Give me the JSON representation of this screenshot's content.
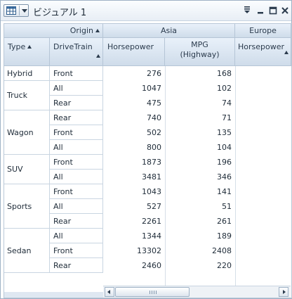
{
  "window": {
    "title": "ビジュアル 1"
  },
  "icons": {
    "menu": "grid-icon",
    "chevron": "chevron-down-icon",
    "filter": "filter-icon",
    "minimize": "minimize-icon",
    "maximize": "maximize-icon",
    "close": "close-icon"
  },
  "columns": {
    "origin_label": "Origin",
    "type_label": "Type",
    "drivetrain_label": "DriveTrain",
    "groups": [
      "Asia",
      "Europe"
    ],
    "measures": [
      "Horsepower",
      "MPG\n(Highway)",
      "Horsepower"
    ]
  },
  "rows": [
    {
      "type": "Hybrid",
      "drivetrain": "Front",
      "hp": "276",
      "mpg": "168"
    },
    {
      "type": "Truck",
      "drivetrain": "All",
      "hp": "1047",
      "mpg": "102"
    },
    {
      "type": "",
      "drivetrain": "Rear",
      "hp": "475",
      "mpg": "74"
    },
    {
      "type": "Wagon",
      "drivetrain": "Rear",
      "hp": "740",
      "mpg": "71"
    },
    {
      "type": "",
      "drivetrain": "Front",
      "hp": "502",
      "mpg": "135"
    },
    {
      "type": "",
      "drivetrain": "All",
      "hp": "800",
      "mpg": "104"
    },
    {
      "type": "SUV",
      "drivetrain": "Front",
      "hp": "1873",
      "mpg": "196"
    },
    {
      "type": "",
      "drivetrain": "All",
      "hp": "3481",
      "mpg": "346"
    },
    {
      "type": "Sports",
      "drivetrain": "Front",
      "hp": "1043",
      "mpg": "141"
    },
    {
      "type": "",
      "drivetrain": "All",
      "hp": "527",
      "mpg": "51"
    },
    {
      "type": "",
      "drivetrain": "Rear",
      "hp": "2261",
      "mpg": "261"
    },
    {
      "type": "Sedan",
      "drivetrain": "All",
      "hp": "1344",
      "mpg": "189"
    },
    {
      "type": "",
      "drivetrain": "Front",
      "hp": "13302",
      "mpg": "2408"
    },
    {
      "type": "",
      "drivetrain": "Rear",
      "hp": "2460",
      "mpg": "220"
    }
  ],
  "type_groups": [
    {
      "label": "Hybrid"
    },
    {
      "label": "Truck"
    },
    {
      "label": "Wagon"
    },
    {
      "label": "SUV"
    },
    {
      "label": "Sports"
    },
    {
      "label": "Sedan"
    }
  ],
  "scrollbar": {
    "grip": "IIII"
  }
}
